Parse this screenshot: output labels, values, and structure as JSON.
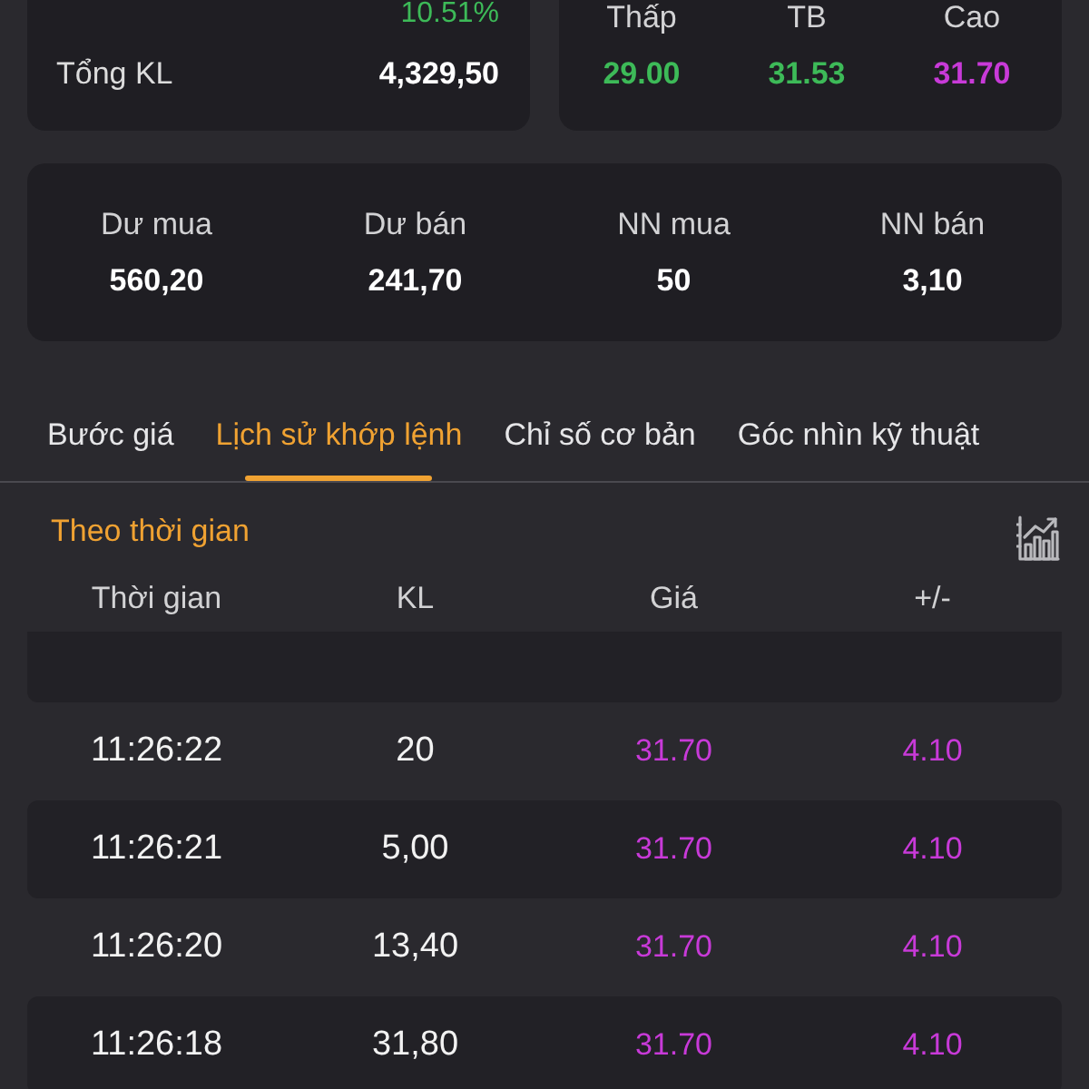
{
  "volume_card": {
    "change": "10.51%",
    "label": "Tổng KL",
    "value": "4,329,50"
  },
  "price_range": [
    {
      "label": "Thấp",
      "value": "29.00",
      "color": "#3dba58"
    },
    {
      "label": "TB",
      "value": "31.53",
      "color": "#3dba58"
    },
    {
      "label": "Cao",
      "value": "31.70",
      "color": "#c83ad8"
    }
  ],
  "trading_stats": [
    {
      "label": "Dư mua",
      "value": "560,20"
    },
    {
      "label": "Dư bán",
      "value": "241,70"
    },
    {
      "label": "NN mua",
      "value": "50"
    },
    {
      "label": "NN bán",
      "value": "3,10"
    }
  ],
  "tabs": [
    {
      "label": "Bước giá",
      "selected": false
    },
    {
      "label": "Lịch sử khớp lệnh",
      "selected": true
    },
    {
      "label": "Chỉ số cơ bản",
      "selected": false
    },
    {
      "label": "Góc nhìn kỹ thuật",
      "selected": false
    }
  ],
  "order_history": {
    "title": "Theo thời gian",
    "columns": [
      "Thời gian",
      "KL",
      "Giá",
      "+/-"
    ],
    "rows": [
      {
        "time": "11:26:22",
        "volume": "20",
        "price": "31.70",
        "change": "4.10",
        "color": "#c83ad8"
      },
      {
        "time": "11:26:21",
        "volume": "5,00",
        "price": "31.70",
        "change": "4.10",
        "color": "#c83ad8"
      },
      {
        "time": "11:26:20",
        "volume": "13,40",
        "price": "31.70",
        "change": "4.10",
        "color": "#c83ad8"
      },
      {
        "time": "11:26:18",
        "volume": "31,80",
        "price": "31.70",
        "change": "4.10",
        "color": "#c83ad8"
      }
    ]
  }
}
